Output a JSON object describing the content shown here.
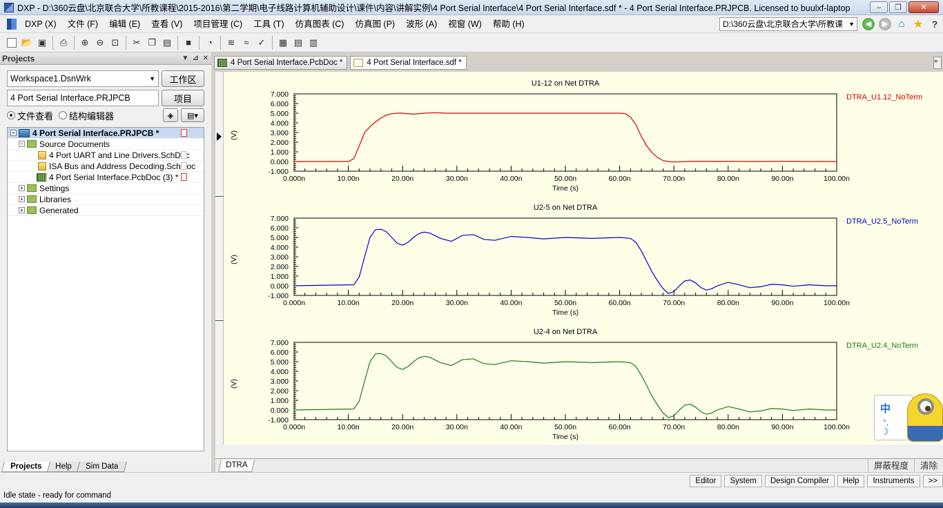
{
  "window": {
    "title": "DXP - D:\\360云盘\\北京联合大学\\所教课程\\2015-2016\\第二学期\\电子线路计算机辅助设计\\课件\\内容\\讲解实例\\4 Port Serial Interface\\4 Port Serial Interface.sdf * - 4 Port Serial Interface.PRJPCB. Licensed to buulxf-laptop",
    "minimize": "–",
    "maximize": "❐",
    "close": "✕"
  },
  "menu": {
    "items": [
      "DXP (X)",
      "文件 (F)",
      "编辑 (E)",
      "查看 (V)",
      "项目管理 (C)",
      "工具 (T)",
      "仿真图表 (C)",
      "仿真图 (P)",
      "波形 (A)",
      "视窗 (W)",
      "帮助 (H)"
    ],
    "path": "D:\\360云盘\\北京联合大学\\所教课",
    "help_glyph": "?"
  },
  "projects_panel": {
    "title": "Projects",
    "workspace": "Workspace1.DsnWrk",
    "workspace_btn": "工作区",
    "project": "4 Port Serial Interface.PRJPCB",
    "project_btn": "项目",
    "radio_file_view": "文件查看",
    "radio_struct_editor": "结构编辑器",
    "tree": {
      "root": "4 Port Serial Interface.PRJPCB *",
      "source_documents": "Source Documents",
      "doc1": "4 Port UART and Line Drivers.SchDoc",
      "doc2": "ISA Bus and Address Decoding.SchDoc",
      "doc3": "4 Port Serial Interface.PcbDoc (3) *",
      "settings": "Settings",
      "libraries": "Libraries",
      "generated": "Generated"
    },
    "tabs": [
      "Projects",
      "Help",
      "Sim Data"
    ]
  },
  "doc_tabs": [
    "4 Port Serial Interface.PcbDoc *",
    "4 Port Serial Interface.sdf *"
  ],
  "wave": {
    "tab": "DTRA",
    "actions": [
      "屏蔽程度",
      "清除"
    ]
  },
  "status": {
    "buttons": [
      "Editor",
      "System",
      "Design Compiler",
      "Help",
      "Instruments",
      ">>"
    ],
    "text": "Idle state - ready for command"
  },
  "ime": {
    "zh": "中",
    "dot": "°,",
    "moon": "☽"
  },
  "chart_data": [
    {
      "type": "line",
      "title": "U1-12 on Net DTRA",
      "xlabel": "Time (s)",
      "ylabel": "(V)",
      "xlim": [
        0,
        100
      ],
      "ylim": [
        -1,
        7
      ],
      "xticks": [
        "0.000n",
        "10.00n",
        "20.00n",
        "30.00n",
        "40.00n",
        "50.00n",
        "60.00n",
        "70.00n",
        "80.00n",
        "90.00n",
        "100.00n"
      ],
      "yticks": [
        "7.000",
        "6.000",
        "5.000",
        "4.000",
        "3.000",
        "2.000",
        "1.000",
        "0.000",
        "-1.000"
      ],
      "legend_position": "top-right",
      "color": "#d40000",
      "series": [
        {
          "name": "DTRA_U1.12_NoTerm",
          "x": [
            0,
            10,
            11,
            12,
            13,
            14,
            15,
            16,
            17,
            18,
            19,
            20,
            22,
            24,
            26,
            28,
            30,
            40,
            50,
            60,
            61,
            62,
            63,
            64,
            65,
            66,
            67,
            68,
            69,
            70,
            72,
            75,
            78,
            80,
            85,
            90,
            95,
            100
          ],
          "y": [
            0,
            0,
            0.3,
            1.6,
            3.0,
            3.6,
            4.1,
            4.5,
            4.8,
            4.95,
            5.0,
            5.0,
            4.9,
            5.0,
            5.05,
            5.0,
            5.0,
            5.0,
            5.0,
            5.0,
            4.95,
            4.6,
            3.8,
            2.6,
            1.6,
            0.9,
            0.4,
            0.1,
            0.0,
            -0.05,
            0.0,
            0.03,
            0.0,
            0.02,
            0.0,
            0.02,
            0.0,
            0.0
          ]
        }
      ]
    },
    {
      "type": "line",
      "title": "U2-5 on Net DTRA",
      "xlabel": "Time (s)",
      "ylabel": "(V)",
      "xlim": [
        0,
        100
      ],
      "ylim": [
        -1,
        7
      ],
      "xticks": [
        "0.000n",
        "10.00n",
        "20.00n",
        "30.00n",
        "40.00n",
        "50.00n",
        "60.00n",
        "70.00n",
        "80.00n",
        "90.00n",
        "100.00n"
      ],
      "yticks": [
        "7.000",
        "6.000",
        "5.000",
        "4.000",
        "3.000",
        "2.000",
        "1.000",
        "0.000",
        "-1.000"
      ],
      "legend_position": "top-right",
      "color": "#0000cc",
      "series": [
        {
          "name": "DTRA_U2.5_NoTerm",
          "x": [
            0,
            11,
            12,
            13,
            14,
            15,
            16,
            17,
            18,
            19,
            20,
            21,
            22,
            23,
            24,
            25,
            27,
            29,
            31,
            33,
            35,
            37,
            40,
            43,
            46,
            50,
            55,
            60,
            62,
            63,
            64,
            65,
            66,
            67,
            68,
            69,
            70,
            71,
            72,
            73,
            74,
            75,
            76,
            77,
            78,
            80,
            82,
            84,
            86,
            88,
            90,
            92,
            95,
            98,
            100
          ],
          "y": [
            0,
            0.1,
            0.9,
            3.0,
            5.0,
            5.8,
            5.85,
            5.6,
            5.0,
            4.4,
            4.2,
            4.5,
            5.0,
            5.4,
            5.55,
            5.45,
            4.9,
            4.6,
            5.2,
            5.3,
            4.8,
            4.7,
            5.1,
            5.0,
            4.85,
            5.0,
            4.9,
            5.0,
            4.9,
            4.5,
            3.6,
            2.5,
            1.4,
            0.5,
            -0.3,
            -0.8,
            -0.6,
            0.0,
            0.5,
            0.6,
            0.3,
            -0.2,
            -0.45,
            -0.3,
            0.0,
            0.35,
            0.1,
            -0.2,
            -0.1,
            0.15,
            0.1,
            -0.05,
            0.1,
            0.0,
            0.0
          ]
        }
      ]
    },
    {
      "type": "line",
      "title": "U2-4 on Net DTRA",
      "xlabel": "Time (s)",
      "ylabel": "(V)",
      "xlim": [
        0,
        100
      ],
      "ylim": [
        -1,
        7
      ],
      "xticks": [
        "0.000n",
        "10.00n",
        "20.00n",
        "30.00n",
        "40.00n",
        "50.00n",
        "60.00n",
        "70.00n",
        "80.00n",
        "90.00n",
        "100.00n"
      ],
      "yticks": [
        "7.000",
        "6.000",
        "5.000",
        "4.000",
        "3.000",
        "2.000",
        "1.000",
        "0.000",
        "-1.000"
      ],
      "legend_position": "top-right",
      "color": "#1a7a1a",
      "series": [
        {
          "name": "DTRA_U2.4_NoTerm",
          "x": [
            0,
            11,
            12,
            13,
            14,
            15,
            16,
            17,
            18,
            19,
            20,
            21,
            22,
            23,
            24,
            25,
            27,
            29,
            31,
            33,
            35,
            37,
            40,
            43,
            46,
            50,
            55,
            60,
            62,
            63,
            64,
            65,
            66,
            67,
            68,
            69,
            70,
            71,
            72,
            73,
            74,
            75,
            76,
            77,
            78,
            80,
            82,
            84,
            86,
            88,
            90,
            92,
            95,
            98,
            100
          ],
          "y": [
            0,
            0.1,
            0.9,
            3.0,
            5.0,
            5.8,
            5.85,
            5.6,
            5.0,
            4.4,
            4.2,
            4.5,
            5.0,
            5.4,
            5.55,
            5.45,
            4.9,
            4.6,
            5.2,
            5.3,
            4.8,
            4.7,
            5.1,
            5.0,
            4.85,
            5.0,
            4.9,
            5.0,
            4.9,
            4.5,
            3.6,
            2.5,
            1.4,
            0.5,
            -0.3,
            -0.8,
            -0.6,
            0.0,
            0.5,
            0.6,
            0.3,
            -0.2,
            -0.45,
            -0.3,
            0.0,
            0.35,
            0.1,
            -0.2,
            -0.1,
            0.15,
            0.1,
            -0.05,
            0.1,
            0.0,
            0.0
          ]
        }
      ]
    }
  ]
}
